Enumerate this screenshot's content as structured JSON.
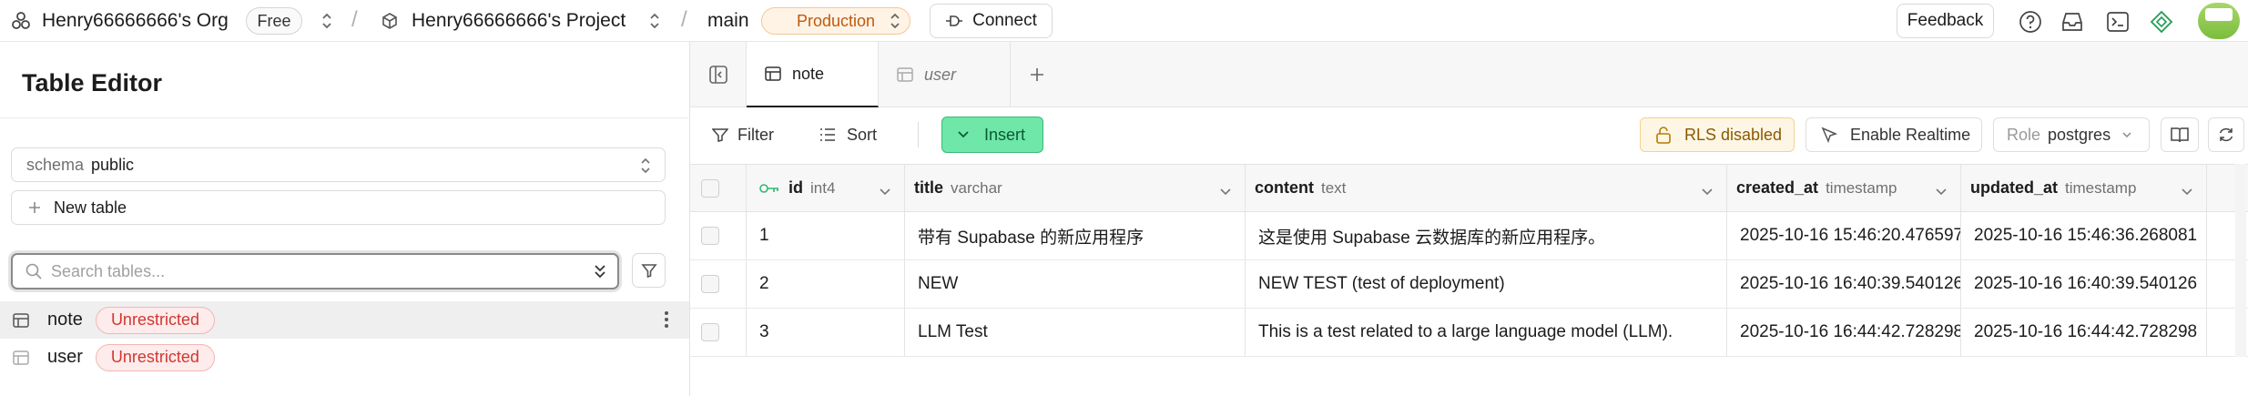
{
  "topbar": {
    "org_name": "Henry66666666's Org",
    "org_plan": "Free",
    "project_name": "Henry66666666's Project",
    "branch": "main",
    "env_badge": "Production",
    "connect_label": "Connect",
    "feedback_label": "Feedback"
  },
  "sidebar": {
    "title": "Table Editor",
    "schema_label": "schema",
    "schema_value": "public",
    "new_table_label": "New table",
    "search_placeholder": "Search tables...",
    "tables": [
      {
        "name": "note",
        "badge": "Unrestricted",
        "active": true
      },
      {
        "name": "user",
        "badge": "Unrestricted",
        "active": false
      }
    ]
  },
  "tabs": [
    {
      "label": "note",
      "active": true
    },
    {
      "label": "user",
      "active": false
    }
  ],
  "toolbar": {
    "filter_label": "Filter",
    "sort_label": "Sort",
    "insert_label": "Insert",
    "rls_label": "RLS disabled",
    "realtime_label": "Enable Realtime",
    "role_label": "Role",
    "role_value": "postgres"
  },
  "columns": [
    {
      "name": "id",
      "type": "int4"
    },
    {
      "name": "title",
      "type": "varchar"
    },
    {
      "name": "content",
      "type": "text"
    },
    {
      "name": "created_at",
      "type": "timestamp"
    },
    {
      "name": "updated_at",
      "type": "timestamp"
    }
  ],
  "rows": [
    {
      "id": "1",
      "title": "带有 Supabase 的新应用程序",
      "content": "这是使用 Supabase 云数据库的新应用程序。",
      "created_at": "2025-10-16 15:46:20.476597",
      "updated_at": "2025-10-16 15:46:36.268081"
    },
    {
      "id": "2",
      "title": "NEW",
      "content": "NEW TEST (test of deployment)",
      "created_at": "2025-10-16 16:40:39.540126",
      "updated_at": "2025-10-16 16:40:39.540126"
    },
    {
      "id": "3",
      "title": "LLM Test",
      "content": "This is a test related to a large language model (LLM).",
      "created_at": "2025-10-16 16:44:42.728298",
      "updated_at": "2025-10-16 16:44:42.728298"
    }
  ],
  "colors": {
    "accent_green": "#6ee7a8",
    "unrestricted_red": "#d2362f",
    "production_orange": "#c2590a",
    "rls_amber": "#f3d38c"
  }
}
